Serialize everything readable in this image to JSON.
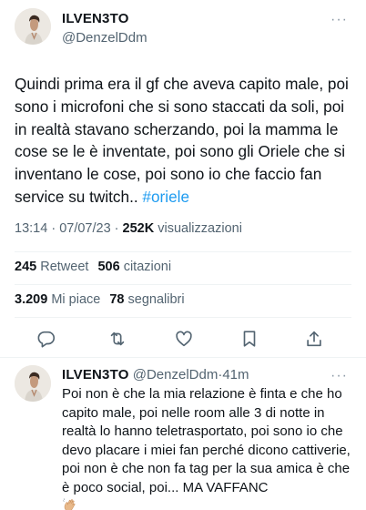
{
  "main_tweet": {
    "author": {
      "name": "ILVEN3TO",
      "handle": "@DenzelDdm"
    },
    "more": "···",
    "text": "Quindi prima era il gf che aveva capito male, poi sono i microfoni che si sono staccati da soli, poi in realtà stavano scherzando, poi la mamma le cose se le è inventate, poi sono gli Oriele che si inventano le cose, poi sono io che faccio fan service su twitch.. ",
    "hashtag": "#oriele",
    "time": "13:14",
    "date": "07/07/23",
    "meta_sep": " · ",
    "views_count": "252K",
    "views_label": "visualizzazioni",
    "retweets_count": "245",
    "retweets_label": "Retweet",
    "quotes_count": "506",
    "quotes_label": "citazioni",
    "likes_count": "3.209",
    "likes_label": "Mi piace",
    "bookmarks_count": "78",
    "bookmarks_label": "segnalibri"
  },
  "actions": [
    {
      "icon": "reply-icon"
    },
    {
      "icon": "retweet-icon"
    },
    {
      "icon": "like-icon"
    },
    {
      "icon": "bookmark-icon"
    },
    {
      "icon": "share-icon"
    }
  ],
  "reply": {
    "author": {
      "name": "ILVEN3TO",
      "handle": "@DenzelDdm"
    },
    "sep": "·",
    "time": "41m",
    "more": "···",
    "text": "Poi non è che la mia relazione è finta e che ho capito male, poi nelle room alle 3 di notte in realtà lo hanno teletrasportato, poi sono io che devo placare i miei fan perché dicono cattiverie, poi non è che non fa tag per la sua amica è che è poco social, poi... MA VAFFANC",
    "emoji": "waving-hand-emoji"
  },
  "colors": {
    "text": "#0f1419",
    "secondary": "#536471",
    "link": "#1d9bf0",
    "divider": "#eff3f4"
  }
}
